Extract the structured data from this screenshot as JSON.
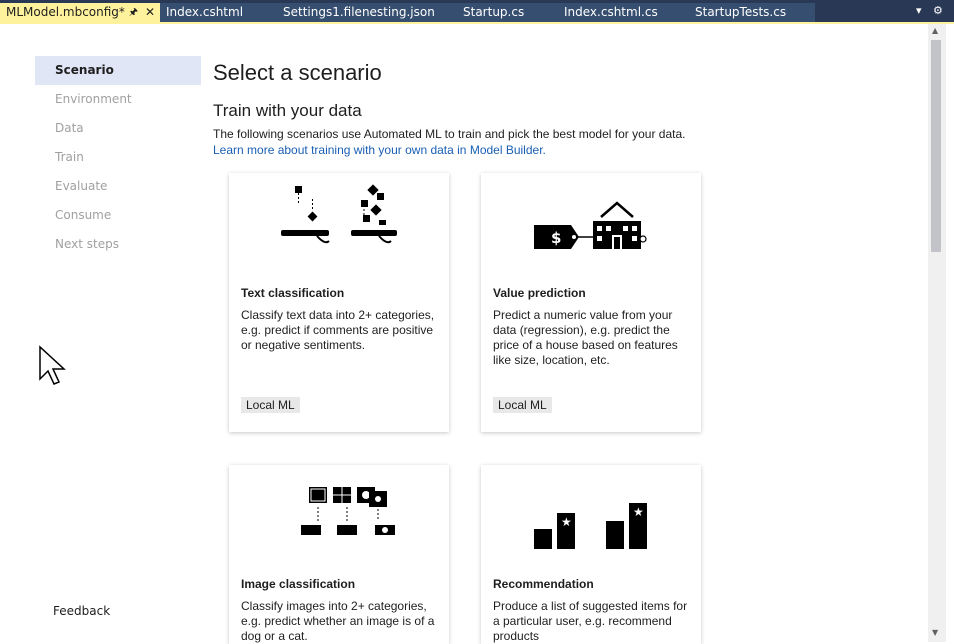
{
  "tabs": [
    {
      "label": "MLModel.mbconfig*",
      "active": true
    },
    {
      "label": "Index.cshtml",
      "active": false
    },
    {
      "label": "Settings1.filenesting.json",
      "active": false
    },
    {
      "label": "Startup.cs",
      "active": false
    },
    {
      "label": "Index.cshtml.cs",
      "active": false
    },
    {
      "label": "StartupTests.cs",
      "active": false
    }
  ],
  "nav": {
    "items": [
      "Scenario",
      "Environment",
      "Data",
      "Train",
      "Evaluate",
      "Consume",
      "Next steps"
    ],
    "selected": "Scenario",
    "feedback": "Feedback"
  },
  "main": {
    "title": "Select a scenario",
    "subtitle": "Train with your data",
    "description": "The following scenarios use Automated ML to train and pick the best model for your data.",
    "link": "Learn more about training with your own data in Model Builder.",
    "cards": [
      {
        "title": "Text classification",
        "body": "Classify text data into 2+ categories, e.g. predict if comments are positive or negative sentiments.",
        "badge": "Local ML",
        "icon": "text-classification-icon"
      },
      {
        "title": "Value prediction",
        "body": "Predict a numeric value from your data (regression), e.g. predict the price of a house based on features like size, location, etc.",
        "badge": "Local ML",
        "icon": "value-prediction-icon"
      },
      {
        "title": "Image classification",
        "body": "Classify images into 2+ categories, e.g. predict whether an image is of a dog or a cat.",
        "badge": "",
        "icon": "image-classification-icon"
      },
      {
        "title": "Recommendation",
        "body": "Produce a list of suggested items for a particular user, e.g. recommend products",
        "badge": "",
        "icon": "recommendation-icon"
      }
    ]
  },
  "colors": {
    "tab_strip": "#293955",
    "active_tab": "#fff29d",
    "nav_selected": "#e1e6f6",
    "link": "#1a5fb4"
  }
}
